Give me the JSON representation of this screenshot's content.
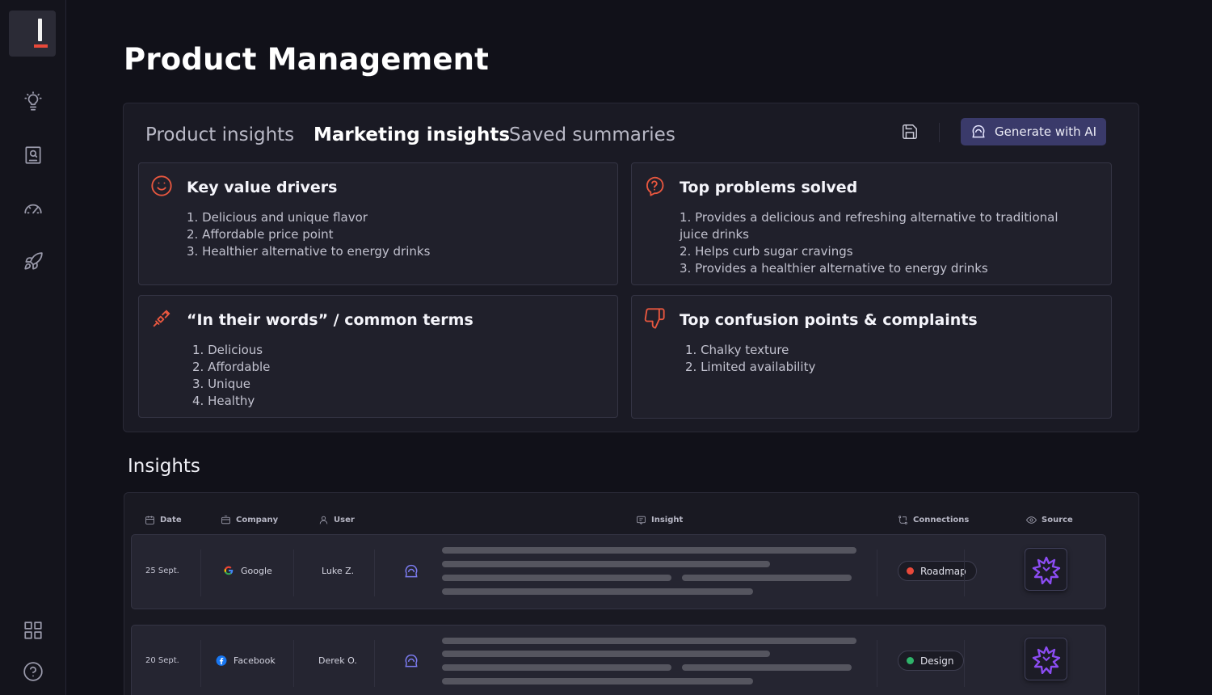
{
  "page": {
    "title": "Product Management"
  },
  "tabs": [
    {
      "label": "Product insights"
    },
    {
      "label": "Marketing insights"
    },
    {
      "label": "Saved summaries"
    }
  ],
  "toolbar": {
    "generate_label": "Generate with AI"
  },
  "cards": {
    "key_value": {
      "title": "Key value drivers",
      "items": [
        "1. Delicious and unique flavor",
        "2. Affordable price point",
        "3. Healthier alternative to energy drinks"
      ]
    },
    "top_problems": {
      "title": "Top problems solved",
      "items": [
        "1. Provides a delicious and refreshing alternative to traditional juice drinks",
        "2. Helps curb sugar cravings",
        "3. Provides a healthier alternative to energy drinks"
      ]
    },
    "their_words": {
      "title": "“In their words” / common terms",
      "items": [
        "1. Delicious",
        "2. Affordable",
        "3. Unique",
        "4. Healthy"
      ]
    },
    "confusion": {
      "title": "Top confusion points & complaints",
      "items": [
        "1. Chalky texture",
        "2. Limited availability"
      ]
    }
  },
  "insights": {
    "section_title": "Insights",
    "columns": {
      "date": "Date",
      "company": "Company",
      "user": "User",
      "insight": "Insight",
      "connections": "Connections",
      "source": "Source"
    },
    "rows": [
      {
        "date": "25 Sept.",
        "company": "Google",
        "user": "Luke Z.",
        "tag": "Roadmap",
        "tag_color": "#e8493a"
      },
      {
        "date": "20 Sept.",
        "company": "Facebook",
        "user": "Derek O.",
        "tag": "Design",
        "tag_color": "#2fb36a"
      }
    ]
  },
  "colors": {
    "accent": "#e8573f",
    "primary_button": "#3a3a6a",
    "background": "#111119"
  }
}
